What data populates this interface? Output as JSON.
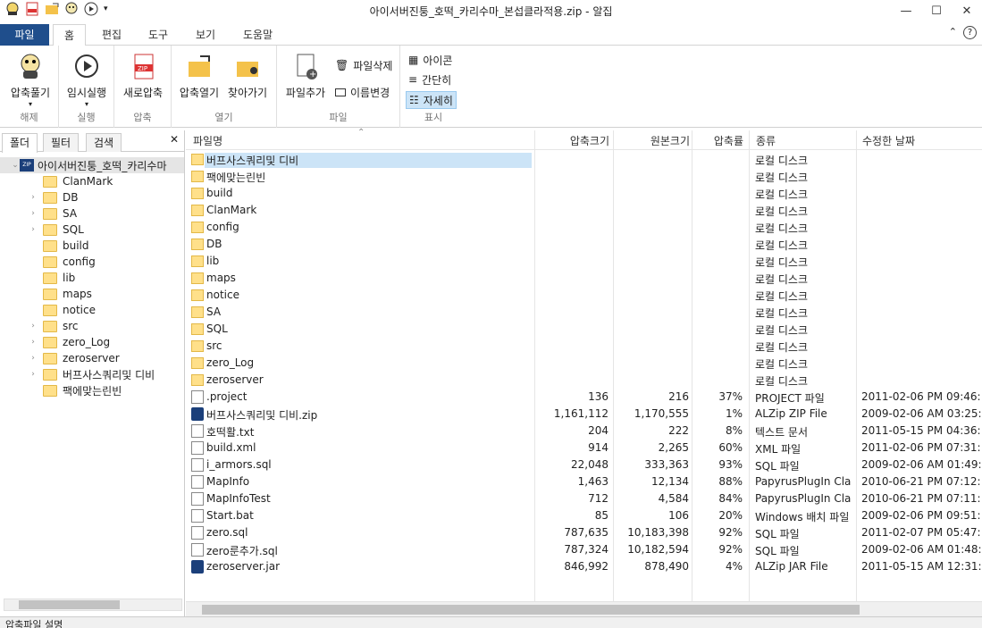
{
  "window": {
    "title": "아이서버진퉁_호떡_카리수마_본섭클라적용.zip - 알집"
  },
  "ribbon_tabs": [
    {
      "label": "파일"
    },
    {
      "label": "홈"
    },
    {
      "label": "편집"
    },
    {
      "label": "도구"
    },
    {
      "label": "보기"
    },
    {
      "label": "도움말"
    }
  ],
  "ribbon": {
    "extract": {
      "button": "압축풀기",
      "group": "해제"
    },
    "run": {
      "button": "임시실행",
      "group": "실행"
    },
    "compress": {
      "button": "새로압축",
      "group": "압축"
    },
    "open": {
      "btn1": "압축열기",
      "btn2": "찾아가기",
      "group": "열기"
    },
    "file": {
      "add": "파일추가",
      "delete": "파일삭제",
      "rename": "이름변경",
      "group": "파일"
    },
    "view": {
      "icon": "아이콘",
      "simple": "간단히",
      "detail": "자세히",
      "group": "표시"
    }
  },
  "left_tabs": [
    {
      "label": "폴더"
    },
    {
      "label": "필터"
    },
    {
      "label": "검색"
    }
  ],
  "tree": {
    "root": "아이서버진퉁_호떡_카리수마",
    "items": [
      "ClanMark",
      "DB",
      "SA",
      "SQL",
      "build",
      "config",
      "lib",
      "maps",
      "notice",
      "src",
      "zero_Log",
      "zeroserver",
      "버프사스쿼리및 디비",
      "팩에맞는린빈"
    ]
  },
  "columns": {
    "name": "파일명",
    "packed": "압축크기",
    "orig": "원본크기",
    "ratio": "압축률",
    "type": "종류",
    "date": "수정한 날짜"
  },
  "files": [
    {
      "name": "버프사스쿼리및 디비",
      "packed": "",
      "orig": "",
      "ratio": "",
      "type": "로컬 디스크",
      "date": "",
      "icon": "folder"
    },
    {
      "name": "팩에맞는린빈",
      "packed": "",
      "orig": "",
      "ratio": "",
      "type": "로컬 디스크",
      "date": "",
      "icon": "folder"
    },
    {
      "name": "build",
      "packed": "",
      "orig": "",
      "ratio": "",
      "type": "로컬 디스크",
      "date": "",
      "icon": "folder"
    },
    {
      "name": "ClanMark",
      "packed": "",
      "orig": "",
      "ratio": "",
      "type": "로컬 디스크",
      "date": "",
      "icon": "folder"
    },
    {
      "name": "config",
      "packed": "",
      "orig": "",
      "ratio": "",
      "type": "로컬 디스크",
      "date": "",
      "icon": "folder"
    },
    {
      "name": "DB",
      "packed": "",
      "orig": "",
      "ratio": "",
      "type": "로컬 디스크",
      "date": "",
      "icon": "folder"
    },
    {
      "name": "lib",
      "packed": "",
      "orig": "",
      "ratio": "",
      "type": "로컬 디스크",
      "date": "",
      "icon": "folder"
    },
    {
      "name": "maps",
      "packed": "",
      "orig": "",
      "ratio": "",
      "type": "로컬 디스크",
      "date": "",
      "icon": "folder"
    },
    {
      "name": "notice",
      "packed": "",
      "orig": "",
      "ratio": "",
      "type": "로컬 디스크",
      "date": "",
      "icon": "folder"
    },
    {
      "name": "SA",
      "packed": "",
      "orig": "",
      "ratio": "",
      "type": "로컬 디스크",
      "date": "",
      "icon": "folder"
    },
    {
      "name": "SQL",
      "packed": "",
      "orig": "",
      "ratio": "",
      "type": "로컬 디스크",
      "date": "",
      "icon": "folder"
    },
    {
      "name": "src",
      "packed": "",
      "orig": "",
      "ratio": "",
      "type": "로컬 디스크",
      "date": "",
      "icon": "folder"
    },
    {
      "name": "zero_Log",
      "packed": "",
      "orig": "",
      "ratio": "",
      "type": "로컬 디스크",
      "date": "",
      "icon": "folder"
    },
    {
      "name": "zeroserver",
      "packed": "",
      "orig": "",
      "ratio": "",
      "type": "로컬 디스크",
      "date": "",
      "icon": "folder"
    },
    {
      "name": ".project",
      "packed": "136",
      "orig": "216",
      "ratio": "37%",
      "type": "PROJECT 파일",
      "date": "2011-02-06 PM 09:46:...",
      "icon": "doc"
    },
    {
      "name": "버프사스쿼리및 디비.zip",
      "packed": "1,161,112",
      "orig": "1,170,555",
      "ratio": "1%",
      "type": "ALZip ZIP File",
      "date": "2009-02-06 AM 03:25:...",
      "icon": "zip"
    },
    {
      "name": "호떡활.txt",
      "packed": "204",
      "orig": "222",
      "ratio": "8%",
      "type": "텍스트 문서",
      "date": "2011-05-15 PM 04:36:...",
      "icon": "doc"
    },
    {
      "name": "build.xml",
      "packed": "914",
      "orig": "2,265",
      "ratio": "60%",
      "type": "XML 파일",
      "date": "2011-02-06 PM 07:31:...",
      "icon": "doc"
    },
    {
      "name": "i_armors.sql",
      "packed": "22,048",
      "orig": "333,363",
      "ratio": "93%",
      "type": "SQL 파일",
      "date": "2009-02-06 AM 01:49:...",
      "icon": "doc"
    },
    {
      "name": "MapInfo",
      "packed": "1,463",
      "orig": "12,134",
      "ratio": "88%",
      "type": "PapyrusPlugIn Cla...",
      "date": "2010-06-21 PM 07:12:...",
      "icon": "doc"
    },
    {
      "name": "MapInfoTest",
      "packed": "712",
      "orig": "4,584",
      "ratio": "84%",
      "type": "PapyrusPlugIn Cla...",
      "date": "2010-06-21 PM 07:11:...",
      "icon": "doc"
    },
    {
      "name": "Start.bat",
      "packed": "85",
      "orig": "106",
      "ratio": "20%",
      "type": "Windows 배치 파일",
      "date": "2009-02-06 PM 09:51:...",
      "icon": "doc"
    },
    {
      "name": "zero.sql",
      "packed": "787,635",
      "orig": "10,183,398",
      "ratio": "92%",
      "type": "SQL 파일",
      "date": "2011-02-07 PM 05:47:...",
      "icon": "doc"
    },
    {
      "name": "zero룬추가.sql",
      "packed": "787,324",
      "orig": "10,182,594",
      "ratio": "92%",
      "type": "SQL 파일",
      "date": "2009-02-06 AM 01:48:...",
      "icon": "doc"
    },
    {
      "name": "zeroserver.jar",
      "packed": "846,992",
      "orig": "878,490",
      "ratio": "4%",
      "type": "ALZip JAR File",
      "date": "2011-05-15 AM 12:31:...",
      "icon": "zip"
    }
  ],
  "status": "압축파일 설명"
}
